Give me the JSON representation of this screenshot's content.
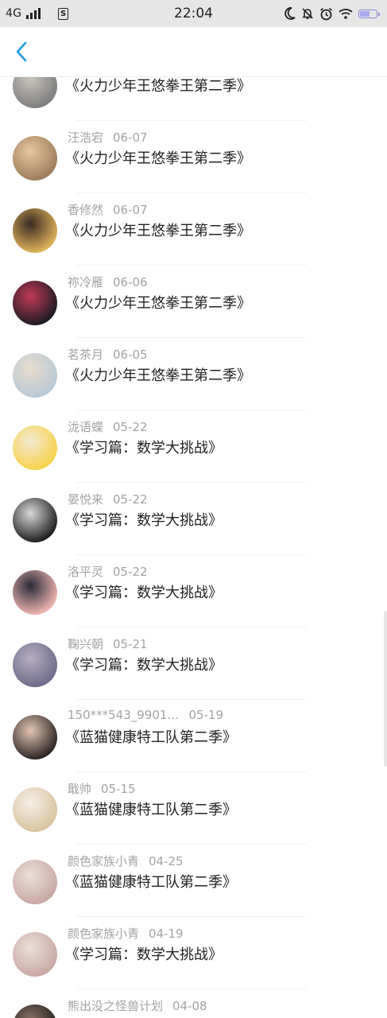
{
  "status_bar": {
    "network": "4G",
    "time": "22:04",
    "icons": [
      "signal-icon",
      "sim-icon",
      "moon-icon",
      "mute-bell-icon",
      "alarm-icon",
      "wifi-icon",
      "battery-icon"
    ]
  },
  "header": {
    "back_icon": "chevron-left-icon",
    "accent_color": "#1e9be8"
  },
  "list": [
    {
      "name": "",
      "date": "",
      "title": "《火力少年王悠拳王第二季》",
      "avatar_colors": [
        "#7d7d7d",
        "#c9c4bd"
      ]
    },
    {
      "name": "汪浩宕",
      "date": "06-07",
      "title": "《火力少年王悠拳王第二季》",
      "avatar_colors": [
        "#9c7b5a",
        "#e5c7a0"
      ]
    },
    {
      "name": "香修然",
      "date": "06-07",
      "title": "《火力少年王悠拳王第二季》",
      "avatar_colors": [
        "#e0b55a",
        "#3b2a24"
      ]
    },
    {
      "name": "祢冷雁",
      "date": "06-06",
      "title": "《火力少年王悠拳王第二季》",
      "avatar_colors": [
        "#1a1a22",
        "#c23b57"
      ]
    },
    {
      "name": "茗茶月",
      "date": "06-05",
      "title": "《火力少年王悠拳王第二季》",
      "avatar_colors": [
        "#b8c9d6",
        "#e8dccd"
      ]
    },
    {
      "name": "泷语蝶",
      "date": "05-22",
      "title": "《学习篇：数学大挑战》",
      "avatar_colors": [
        "#f7d34a",
        "#f2e8d2"
      ]
    },
    {
      "name": "晏悦来",
      "date": "05-22",
      "title": "《学习篇：数学大挑战》",
      "avatar_colors": [
        "#1b1b1b",
        "#d9d9d9"
      ]
    },
    {
      "name": "洛平灵",
      "date": "05-22",
      "title": "《学习篇：数学大挑战》",
      "avatar_colors": [
        "#f0b7b0",
        "#2b2b3a"
      ]
    },
    {
      "name": "鞠兴朝",
      "date": "05-21",
      "title": "《学习篇：数学大挑战》",
      "avatar_colors": [
        "#6f6a8a",
        "#b5aec4"
      ]
    },
    {
      "name": "150***543_9901…",
      "date": "05-19",
      "title": "《蓝猫健康特工队第二季》",
      "avatar_colors": [
        "#2a2222",
        "#e3c5b0"
      ]
    },
    {
      "name": "戢帅",
      "date": "05-15",
      "title": "《蓝猫健康特工队第二季》",
      "avatar_colors": [
        "#d9c2a0",
        "#f6efe5"
      ]
    },
    {
      "name": "颜色家族小青",
      "date": "04-25",
      "title": "《蓝猫健康特工队第二季》",
      "avatar_colors": [
        "#c9a7a3",
        "#ece0d8"
      ]
    },
    {
      "name": "颜色家族小青",
      "date": "04-19",
      "title": "《学习篇：数学大挑战》",
      "avatar_colors": [
        "#c9a7a3",
        "#ece0d8"
      ]
    },
    {
      "name": "熊出没之怪兽计划",
      "date": "04-08",
      "title": "",
      "avatar_colors": [
        "#1e1e1e",
        "#8a7060"
      ]
    }
  ]
}
